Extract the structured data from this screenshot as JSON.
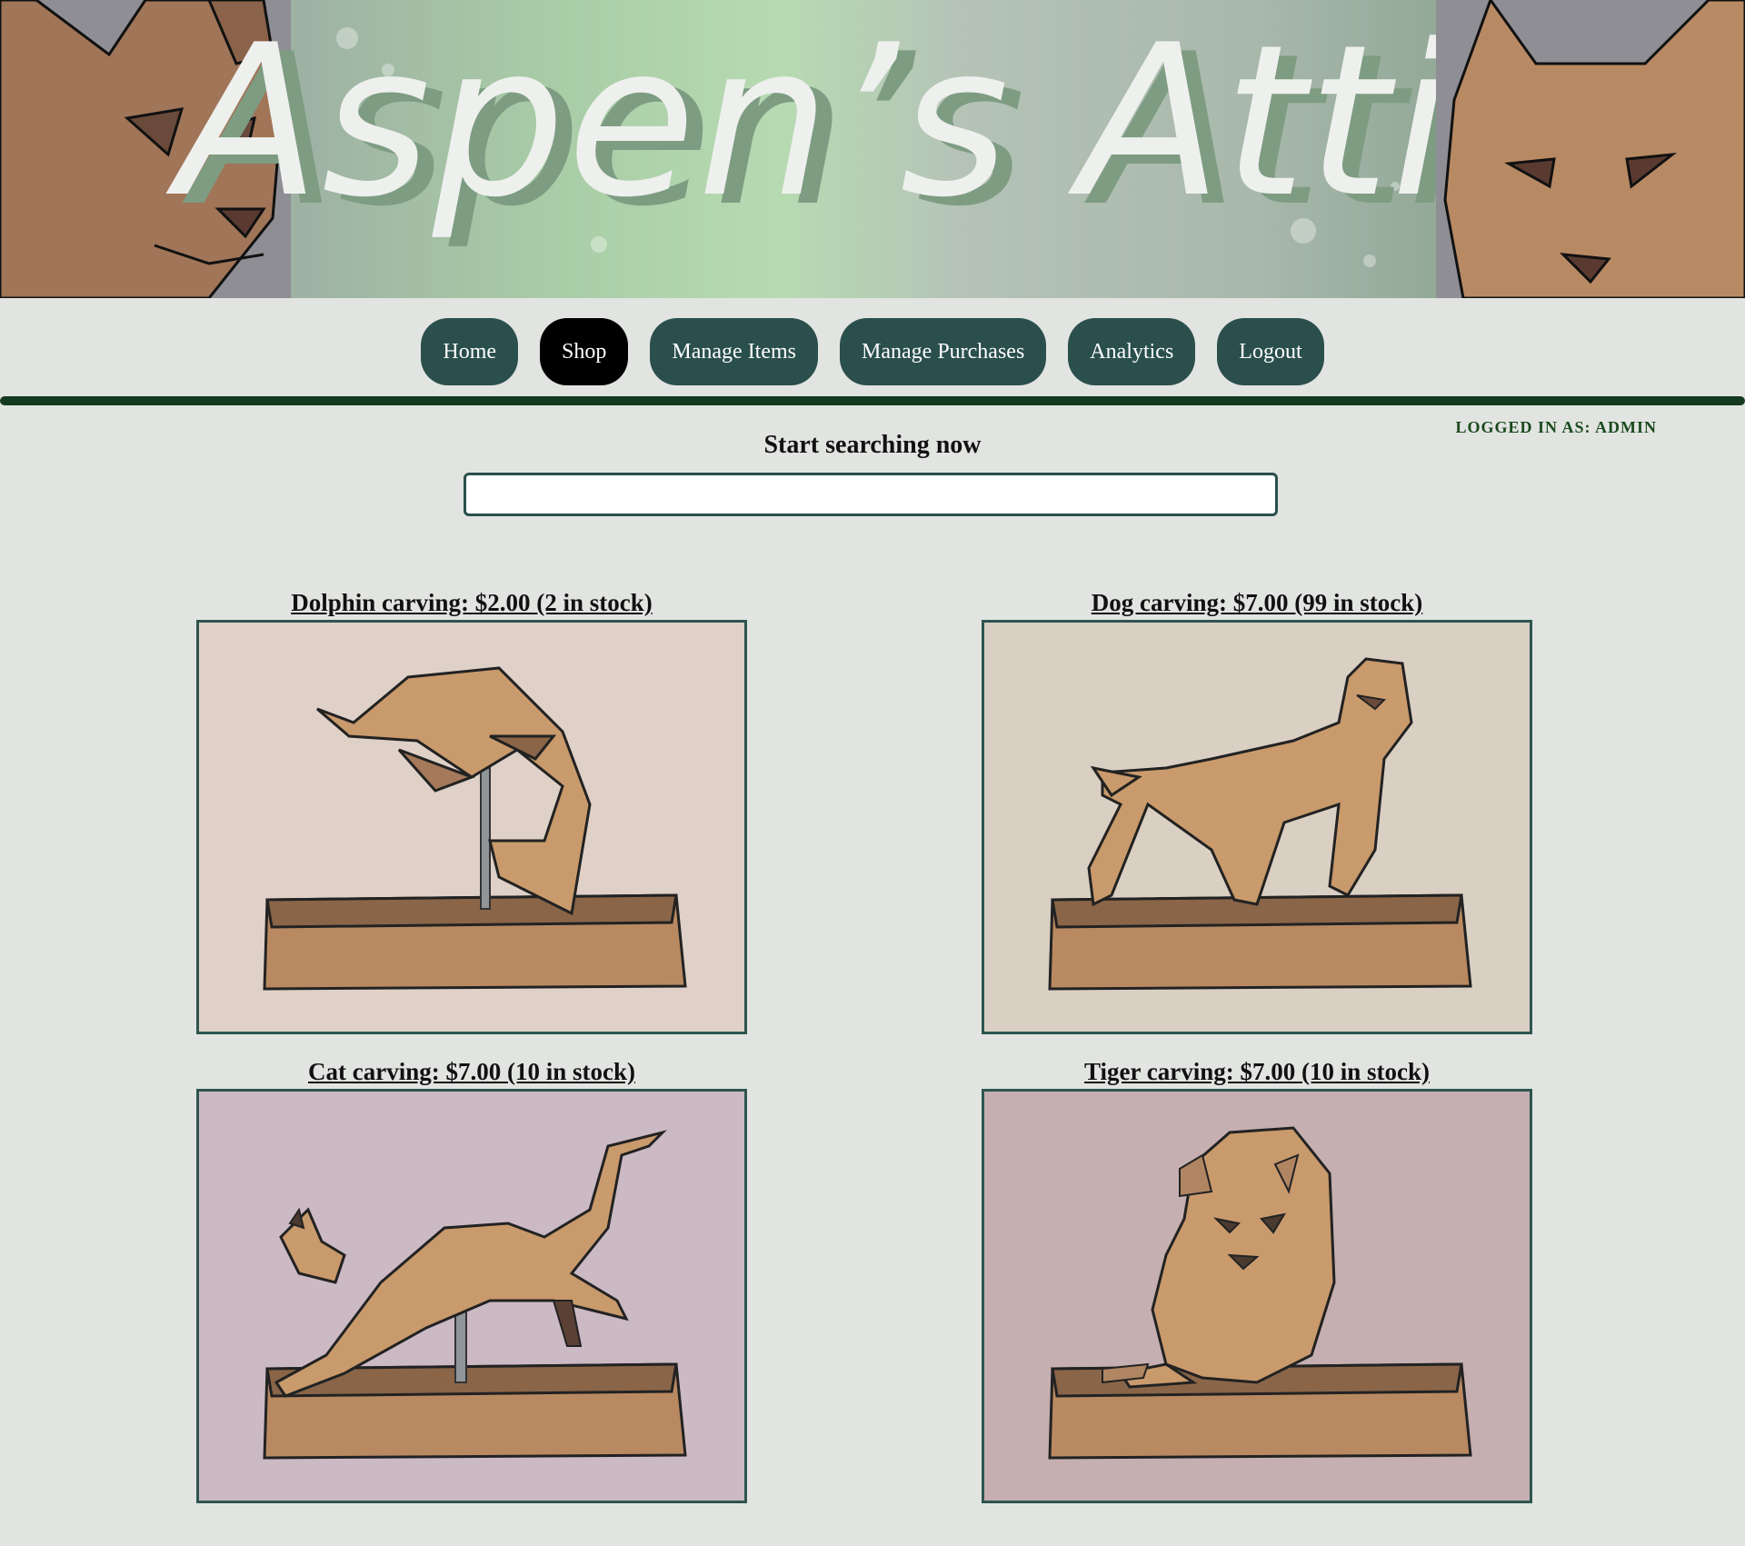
{
  "banner": {
    "title": "Aspen’s Attic"
  },
  "nav": {
    "items": [
      {
        "label": "Home",
        "active": false
      },
      {
        "label": "Shop",
        "active": true
      },
      {
        "label": "Manage Items",
        "active": false
      },
      {
        "label": "Manage Purchases",
        "active": false
      },
      {
        "label": "Analytics",
        "active": false
      },
      {
        "label": "Logout",
        "active": false
      }
    ]
  },
  "session": {
    "logged_in_text": "LOGGED IN AS: ADMIN"
  },
  "search": {
    "title": "Start searching now",
    "value": "",
    "placeholder": ""
  },
  "products": [
    {
      "title": "Dolphin carving: $2.00 (2 in stock)",
      "bg": "#dfd1c8",
      "icon": "dolphin-carving-image"
    },
    {
      "title": "Dog carving: $7.00 (99 in stock)",
      "bg": "#d9cfc3",
      "icon": "dog-carving-image"
    },
    {
      "title": "Cat carving: $7.00 (10 in stock)",
      "bg": "#cbb9c4",
      "icon": "cat-carving-image"
    },
    {
      "title": "Tiger carving: $7.00 (10 in stock)",
      "bg": "#c5afb0",
      "icon": "tiger-carving-image"
    }
  ],
  "colors": {
    "nav_button": "#2a4f4c",
    "nav_active": "#000000",
    "divider": "#143a1f",
    "page_bg": "#e2e4e1",
    "wood": "#c99a6c"
  }
}
